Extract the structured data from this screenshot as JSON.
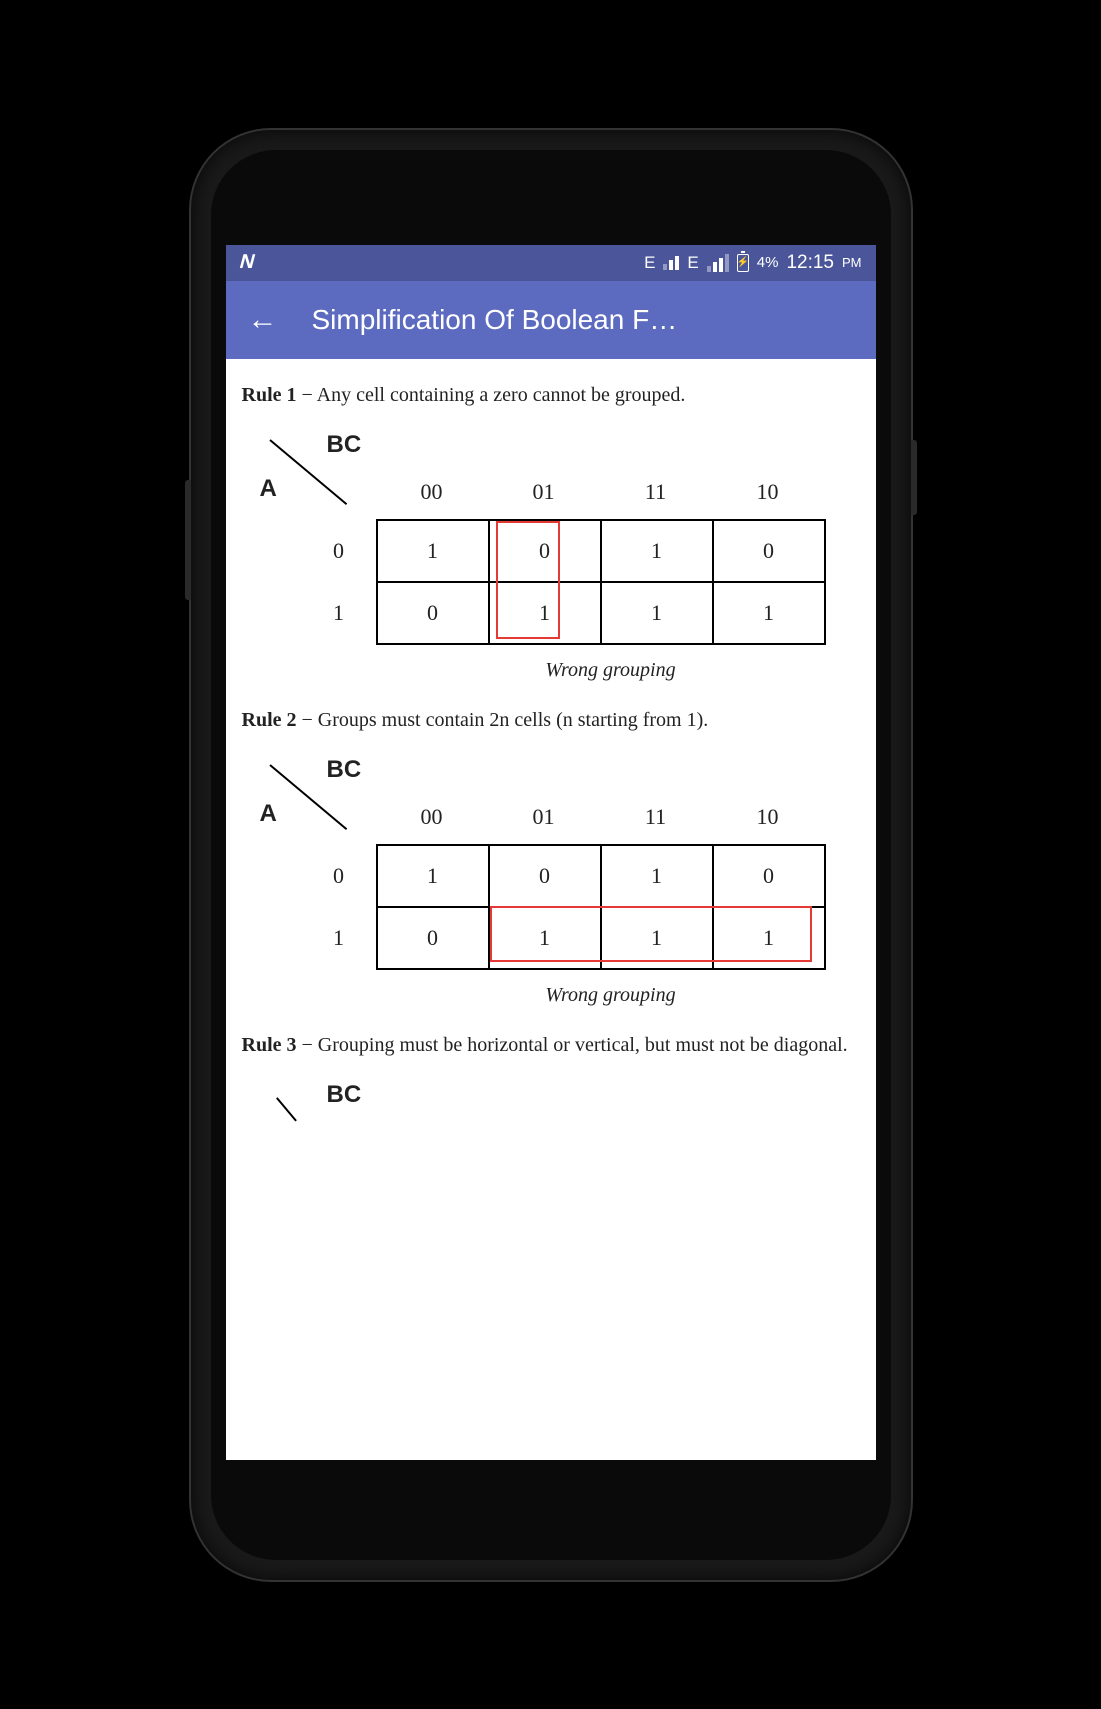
{
  "status_bar": {
    "e_label": "E",
    "battery_pct": "4%",
    "time": "12:15",
    "time_suffix": "PM"
  },
  "app_bar": {
    "title": "Simplification Of Boolean F…"
  },
  "rules": {
    "rule1": {
      "label": "Rule 1",
      "text": " − Any cell containing a zero cannot be grouped."
    },
    "rule2": {
      "label": "Rule 2",
      "text": " − Groups must contain 2n cells (n starting from 1)."
    },
    "rule3": {
      "label": "Rule 3",
      "text": " − Grouping must be horizontal or vertical, but must not be diagonal."
    }
  },
  "kmap": {
    "bc_label": "BC",
    "a_label": "A",
    "col_headers": [
      "00",
      "01",
      "11",
      "10"
    ],
    "row_labels": [
      "0",
      "1"
    ],
    "map1": {
      "rows": [
        [
          "1",
          "0",
          "1",
          "0"
        ],
        [
          "0",
          "1",
          "1",
          "1"
        ]
      ],
      "caption": "Wrong grouping"
    },
    "map2": {
      "rows": [
        [
          "1",
          "0",
          "1",
          "0"
        ],
        [
          "0",
          "1",
          "1",
          "1"
        ]
      ],
      "caption": "Wrong grouping"
    }
  },
  "chart_data": [
    {
      "type": "table",
      "title": "K-map Rule 1 (2x4)",
      "row_var": "A",
      "col_var": "BC",
      "col_headers": [
        "00",
        "01",
        "11",
        "10"
      ],
      "row_headers": [
        "0",
        "1"
      ],
      "values": [
        [
          1,
          0,
          1,
          0
        ],
        [
          0,
          1,
          1,
          1
        ]
      ],
      "annotation": "Wrong grouping: vertical group across 01 column cells {0,1}"
    },
    {
      "type": "table",
      "title": "K-map Rule 2 (2x4)",
      "row_var": "A",
      "col_var": "BC",
      "col_headers": [
        "00",
        "01",
        "11",
        "10"
      ],
      "row_headers": [
        "0",
        "1"
      ],
      "values": [
        [
          1,
          0,
          1,
          0
        ],
        [
          0,
          1,
          1,
          1
        ]
      ],
      "annotation": "Wrong grouping: 3-cell horizontal group row 1 columns 01,11,10"
    }
  ]
}
